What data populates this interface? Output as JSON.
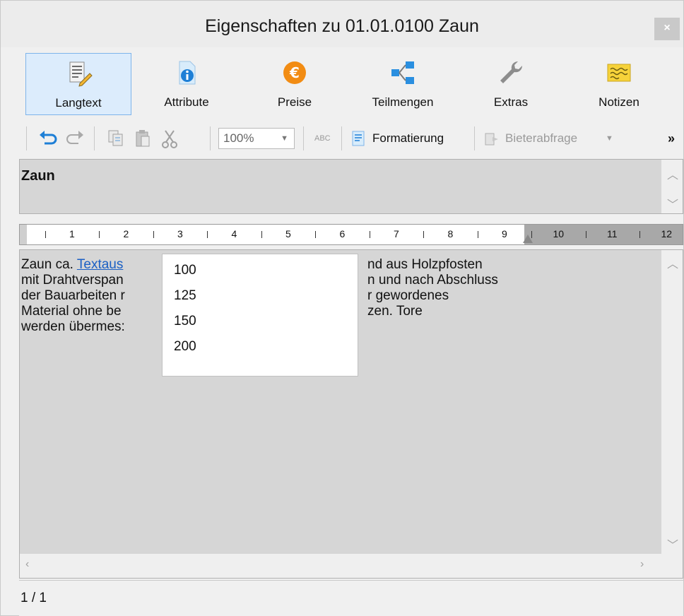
{
  "window": {
    "title": "Eigenschaften zu 01.01.0100 Zaun",
    "close_label": "×"
  },
  "ribbon": {
    "tabs": [
      {
        "label": "Langtext",
        "icon": "langtext-icon",
        "active": true
      },
      {
        "label": "Attribute",
        "icon": "info-icon",
        "active": false
      },
      {
        "label": "Preise",
        "icon": "euro-icon",
        "active": false
      },
      {
        "label": "Teilmengen",
        "icon": "teilmengen-icon",
        "active": false
      },
      {
        "label": "Extras",
        "icon": "wrench-icon",
        "active": false
      },
      {
        "label": "Notizen",
        "icon": "notes-icon",
        "active": false
      }
    ]
  },
  "toolbar": {
    "zoom_value": "100%",
    "spellcheck_label": "ABC",
    "formatierung_label": "Formatierung",
    "bieterabfrage_label": "Bieterabfrage",
    "overflow_label": "»"
  },
  "short_text": "Zaun",
  "ruler": {
    "numbers": [
      "1",
      "2",
      "3",
      "4",
      "5",
      "6",
      "7",
      "8",
      "9",
      "10",
      "11",
      "12"
    ]
  },
  "long_text": {
    "line1_prefix": "Zaun ca. ",
    "line1_link": "Textaus",
    "line1_suffix": "nd aus Holzpfosten",
    "line2_prefix": "mit Drahtverspan",
    "line2_suffix": "n und nach Abschluss",
    "line3_prefix": "der Bauarbeiten r",
    "line3_suffix": "r gewordenes",
    "line4_prefix": "Material ohne be",
    "line4_suffix": "zen. Tore",
    "line5_prefix": "werden übermes:"
  },
  "zoom_dropdown": {
    "options": [
      "100",
      "125",
      "150",
      "200"
    ]
  },
  "status": {
    "page": "1 / 1"
  },
  "colors": {
    "accent": "#dcecfc",
    "accent_border": "#7eb4ea",
    "link": "#1a5fc4",
    "text_background": "#d6d6d6"
  }
}
